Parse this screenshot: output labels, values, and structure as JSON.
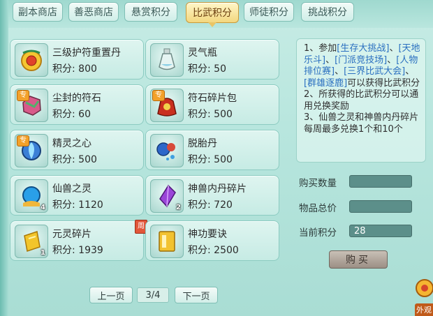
{
  "tabs": [
    {
      "label": "副本商店",
      "active": false
    },
    {
      "label": "善恶商店",
      "active": false
    },
    {
      "label": "悬赏积分",
      "active": false
    },
    {
      "label": "比武积分",
      "active": true
    },
    {
      "label": "师徒积分",
      "active": false
    },
    {
      "label": "挑战积分",
      "active": false
    }
  ],
  "items": [
    {
      "name": "三级护符重置丹",
      "points": "积分: 800",
      "icon": "gold-amulet-icon"
    },
    {
      "name": "灵气瓶",
      "points": "积分: 50",
      "icon": "spirit-bottle-icon"
    },
    {
      "name": "尘封的符石",
      "points": "积分: 60",
      "icon": "sealed-rune-stone-icon",
      "badge": "专"
    },
    {
      "name": "符石碎片包",
      "points": "积分: 500",
      "icon": "rune-fragment-bag-icon",
      "badge": "专"
    },
    {
      "name": "精灵之心",
      "points": "积分: 500",
      "icon": "spirit-heart-icon",
      "badge": "专"
    },
    {
      "name": "脱胎丹",
      "points": "积分: 500",
      "icon": "rebirth-pill-icon"
    },
    {
      "name": "仙兽之灵",
      "points": "积分: 1120",
      "icon": "beast-spirit-orb-icon",
      "qty": "4"
    },
    {
      "name": "神兽内丹碎片",
      "points": "积分: 720",
      "icon": "beast-core-fragment-icon",
      "qty": "2"
    },
    {
      "name": "元灵碎片",
      "points": "积分: 1939",
      "icon": "yuanling-fragment-icon",
      "qty": "1",
      "weekly": "周"
    },
    {
      "name": "神功要诀",
      "points": "积分: 2500",
      "icon": "skill-book-icon"
    }
  ],
  "info": {
    "line1_prefix": "1、参加",
    "link1": "[生存大挑战]",
    "sep": "、",
    "link2": "[天地乐斗]",
    "link3": "[门派竞技场]",
    "link4": "[人物排位赛]",
    "link5": "[三界比武大会]",
    "link6": "[群雄逐鹿]",
    "line1_suffix": "可以获得比武积分",
    "line2": "2、所获得的比武积分可以通用兑换奖励",
    "line3": "3、仙兽之灵和神兽内丹碎片每周最多兑换1个和10个"
  },
  "form": {
    "qty_label": "购买数量",
    "qty_value": "",
    "total_label": "物品总价",
    "total_value": "",
    "current_label": "当前积分",
    "current_value": "28",
    "buy_label": "购买"
  },
  "pager": {
    "prev": "上一页",
    "page": "3/4",
    "next": "下一页"
  },
  "corner_label": "外观",
  "colors": {
    "accent_tab": "#f3d77f",
    "link": "#2a6fc0",
    "badge_zhuan": "#f3a12a",
    "badge_zhou": "#e2573a"
  }
}
